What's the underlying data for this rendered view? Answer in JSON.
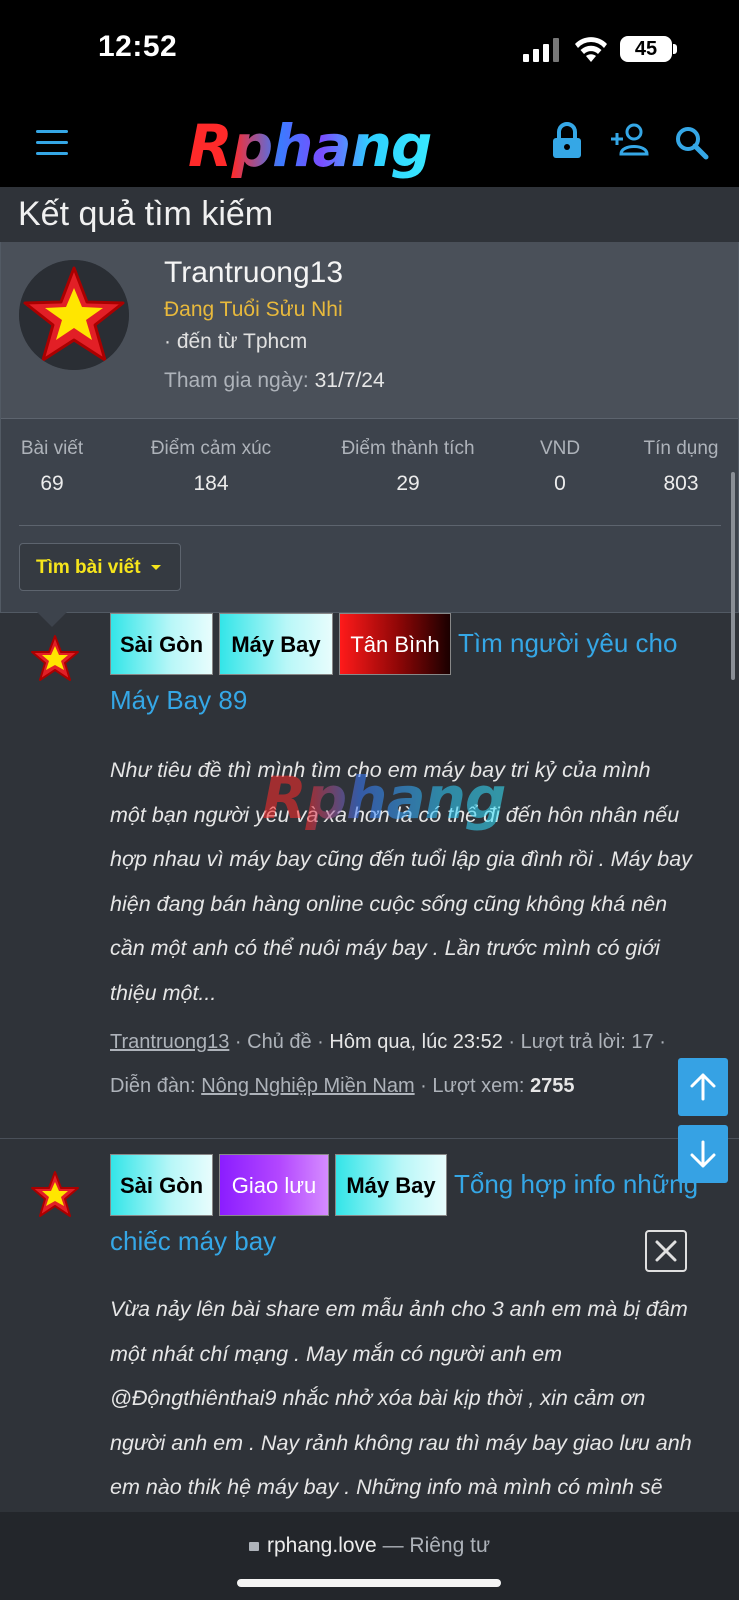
{
  "status_bar": {
    "time": "12:52",
    "battery": "45"
  },
  "header": {
    "logo_text": "Rphang"
  },
  "page": {
    "title": "Kết quả tìm kiếm"
  },
  "member": {
    "username": "Trantruong13",
    "user_title": "Đang Tuổi Sửu Nhi",
    "location": "· đến từ Tphcm",
    "joined_label": "Tham gia ngày:",
    "joined_value": "31/7/24",
    "stats": [
      {
        "label": "Bài viết",
        "value": "69"
      },
      {
        "label": "Điểm cảm xúc",
        "value": "184"
      },
      {
        "label": "Điểm thành tích",
        "value": "29"
      },
      {
        "label": "VND",
        "value": "0"
      },
      {
        "label": "Tín dụng",
        "value": "803"
      }
    ],
    "find_posts_label": "Tìm bài viết"
  },
  "results": [
    {
      "tags": [
        "Sài Gòn",
        "Máy Bay",
        "Tân Bình"
      ],
      "title_line1": "Tìm người yêu cho",
      "title_line2": "Máy Bay 89",
      "snippet": [
        "Như tiêu đề thì mình tìm cho em máy bay tri kỷ của mình",
        "một bạn người yêu và xa hơn là có thể đi đến hôn nhân nếu",
        "hợp nhau vì máy bay cũng đến tuổi lập gia đình rồi . Máy bay",
        "hiện đang bán hàng online cuộc sống cũng không khá nên",
        "cần một anh có thể nuôi máy bay . Lần trước mình có giới",
        "thiệu một..."
      ],
      "author": "Trantruong13",
      "type": "Chủ đề",
      "date": "Hôm qua, lúc 23:52",
      "replies_label": "Lượt trả lời:",
      "replies": "17",
      "forum_label": "Diễn đàn:",
      "forum": "Nông Nghiệp Miền Nam",
      "views_label": "Lượt xem:",
      "views": "2755"
    },
    {
      "tags": [
        "Sài Gòn",
        "Giao lưu",
        "Máy Bay"
      ],
      "title_line1": "Tổng hợp info những",
      "title_line2": "chiếc máy bay",
      "snippet": [
        "Vừa nảy lên bài share em mẫu ảnh cho 3 anh em mà bị đâm",
        "một nhát chí mạng . May mắn có người anh em",
        "@Độngthiênthai9 nhắc nhở xóa bài kịp thời , xin cảm ơn",
        "người anh em . Nay rảnh không rau thì máy bay giao lưu anh",
        "em nào thik hệ máy bay . Những info mà mình có mình sẽ"
      ]
    }
  ],
  "browser": {
    "domain": "rphang.love",
    "separator": "—",
    "privacy": "Riêng tư"
  },
  "colors": {
    "accent": "#35a7e6",
    "title_gold": "#e8b93c",
    "button_yellow": "#f6e51c",
    "background": "#2f3339"
  }
}
